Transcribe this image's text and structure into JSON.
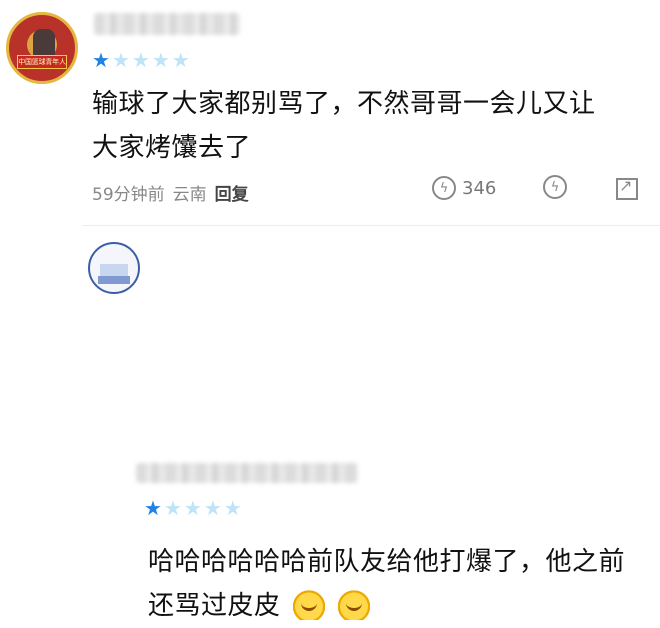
{
  "comments": [
    {
      "avatar_text": "中国篮球青年人",
      "stars": [
        "on",
        "off",
        "off",
        "off",
        "off"
      ],
      "text_lines": [
        "输球了大家都别骂了，不然哥哥一会儿又让",
        "大家烤馕去了"
      ],
      "meta": {
        "time_ago": "59分钟前",
        "location": "云南",
        "reply_label": "回复"
      },
      "likes": "346"
    },
    {
      "stars": [
        "on",
        "off",
        "off",
        "off",
        "off"
      ],
      "text_lines": [
        "哈哈哈哈哈哈前队友给他打爆了，他之前",
        "还骂过皮皮"
      ],
      "emojis": [
        "grinning-emoji",
        "grinning-emoji"
      ]
    }
  ],
  "icons": {
    "like": "like-icon",
    "dislike": "dislike-icon",
    "share": "share-icon"
  },
  "colors": {
    "star_active": "#1e82e6",
    "star_inactive": "#bfe4f7"
  }
}
